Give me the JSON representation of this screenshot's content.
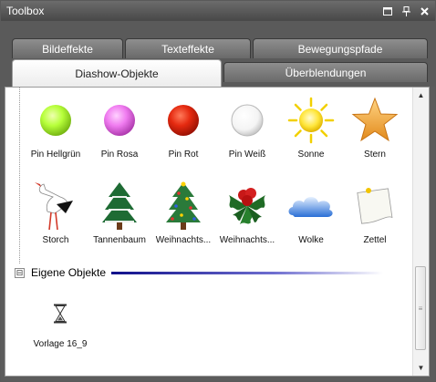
{
  "window": {
    "title": "Toolbox"
  },
  "titlebar_buttons": {
    "pin_icon": "window-position-icon",
    "dock_icon": "pin-icon",
    "close_icon": "close-icon"
  },
  "tabs": {
    "row1": [
      {
        "label": "Bildeffekte"
      },
      {
        "label": "Texteffekte"
      },
      {
        "label": "Bewegungspfade"
      }
    ],
    "row2": [
      {
        "label": "Diashow-Objekte",
        "active": true
      },
      {
        "label": "Überblendungen"
      }
    ]
  },
  "gallery": {
    "row1": [
      {
        "label": "Pin Hellgrün",
        "icon": "pin-green-icon",
        "color": "#b7ff3a"
      },
      {
        "label": "Pin Rosa",
        "icon": "pin-pink-icon",
        "color": "#f07cf0"
      },
      {
        "label": "Pin Rot",
        "icon": "pin-red-icon",
        "color": "#e52a10"
      },
      {
        "label": "Pin Weiß",
        "icon": "pin-white-icon",
        "color": "#ffffff"
      },
      {
        "label": "Sonne",
        "icon": "sun-icon",
        "color": "#ffe63b"
      },
      {
        "label": "Stern",
        "icon": "star-icon",
        "color": "#f2a53b"
      }
    ],
    "row2": [
      {
        "label": "Storch",
        "icon": "stork-icon"
      },
      {
        "label": "Tannenbaum",
        "icon": "fir-tree-icon"
      },
      {
        "label": "Weihnachts...",
        "icon": "christmas-tree-icon"
      },
      {
        "label": "Weihnachts...",
        "icon": "holly-icon"
      },
      {
        "label": "Wolke",
        "icon": "cloud-icon"
      },
      {
        "label": "Zettel",
        "icon": "note-icon"
      }
    ]
  },
  "group": {
    "label": "Eigene Objekte",
    "collapse_symbol": "⊟"
  },
  "own_objects": [
    {
      "label": "Vorlage 16_9",
      "icon": "hourglass-icon"
    }
  ],
  "scrollbar": {
    "up_icon": "scroll-up-arrow-icon",
    "down_icon": "scroll-down-arrow-icon",
    "position": 0.82
  }
}
